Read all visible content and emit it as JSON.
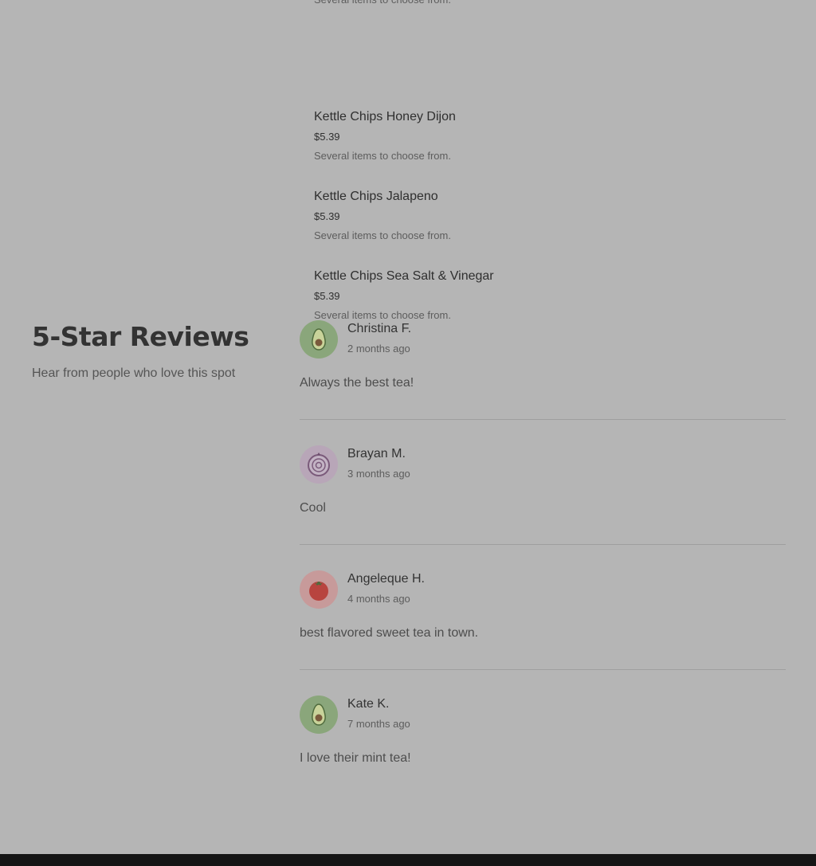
{
  "menu": {
    "items": [
      {
        "name": "",
        "price": "",
        "description": "Several items to choose from."
      },
      {
        "name": "Kettle Chips Honey Dijon",
        "price": "$5.39",
        "description": "Several items to choose from."
      },
      {
        "name": "Kettle Chips Jalapeno",
        "price": "$5.39",
        "description": "Several items to choose from."
      },
      {
        "name": "Kettle Chips Sea Salt & Vinegar",
        "price": "$5.39",
        "description": "Several items to choose from."
      }
    ]
  },
  "reviews": {
    "heading": "5-Star Reviews",
    "subheading": "Hear from people who love this spot",
    "items": [
      {
        "author": "Christina F.",
        "time": "2 months ago",
        "text": "Always the best tea!",
        "avatar_icon": "avocado-icon"
      },
      {
        "author": "Brayan M.",
        "time": "3 months ago",
        "text": "Cool",
        "avatar_icon": "onion-icon"
      },
      {
        "author": "Angeleque H.",
        "time": "4 months ago",
        "text": "best flavored sweet tea in town.",
        "avatar_icon": "tomato-icon"
      },
      {
        "author": "Kate K.",
        "time": "7 months ago",
        "text": "I love their mint tea!",
        "avatar_icon": "avocado-icon"
      }
    ]
  },
  "colors": {
    "overlay_background": "#b5b5b5",
    "avocado_bg": "#8aa67b",
    "onion_bg": "#b8a6b8",
    "tomato_bg": "#c79a9a",
    "footer": "#151515"
  }
}
